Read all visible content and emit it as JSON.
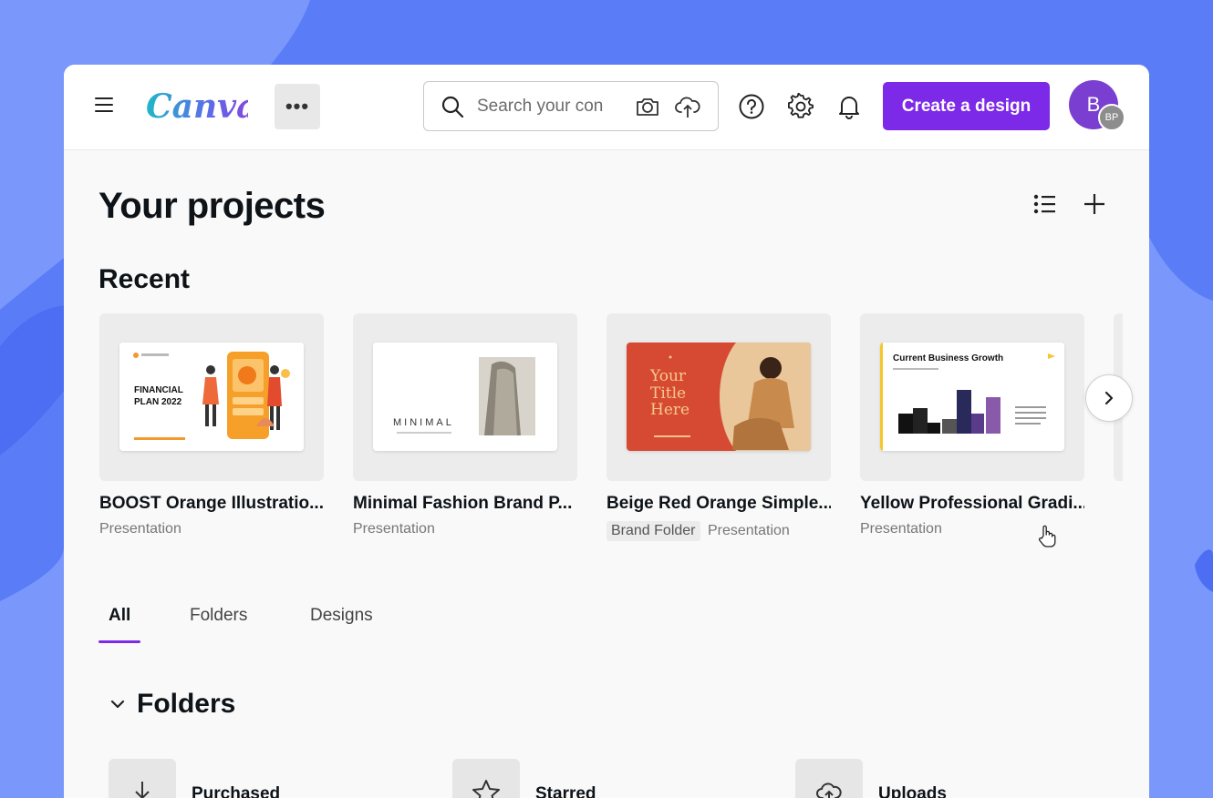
{
  "topbar": {
    "logo": "Canva",
    "more_label": "•••",
    "search_placeholder": "Search your con",
    "create_button": "Create a design",
    "avatar_initial": "B",
    "avatar_badge": "BP"
  },
  "page": {
    "title": "Your projects",
    "recent_title": "Recent"
  },
  "recent": [
    {
      "title": "BOOST Orange Illustratio...",
      "type": "Presentation",
      "badge": "",
      "thumb_text": "FINANCIAL PLAN 2022"
    },
    {
      "title": "Minimal Fashion Brand P...",
      "type": "Presentation",
      "badge": "",
      "thumb_text": "MINIMAL"
    },
    {
      "title": "Beige Red Orange Simple...",
      "type": "Presentation",
      "badge": "Brand Folder",
      "thumb_text": "Your Title Here"
    },
    {
      "title": "Yellow Professional Gradi...",
      "type": "Presentation",
      "badge": "",
      "thumb_text": "Current Business Growth"
    }
  ],
  "tabs": [
    {
      "label": "All",
      "active": true
    },
    {
      "label": "Folders",
      "active": false
    },
    {
      "label": "Designs",
      "active": false
    }
  ],
  "folders_section": {
    "title": "Folders",
    "items": [
      {
        "name": "Purchased",
        "icon": "download-icon"
      },
      {
        "name": "Starred",
        "icon": "star-icon"
      },
      {
        "name": "Uploads",
        "icon": "cloud-upload-icon"
      }
    ]
  },
  "colors": {
    "brand_purple": "#7d2ae8",
    "background_blue": "#5b7cf7",
    "logo_teal": "#1fb7c9"
  }
}
